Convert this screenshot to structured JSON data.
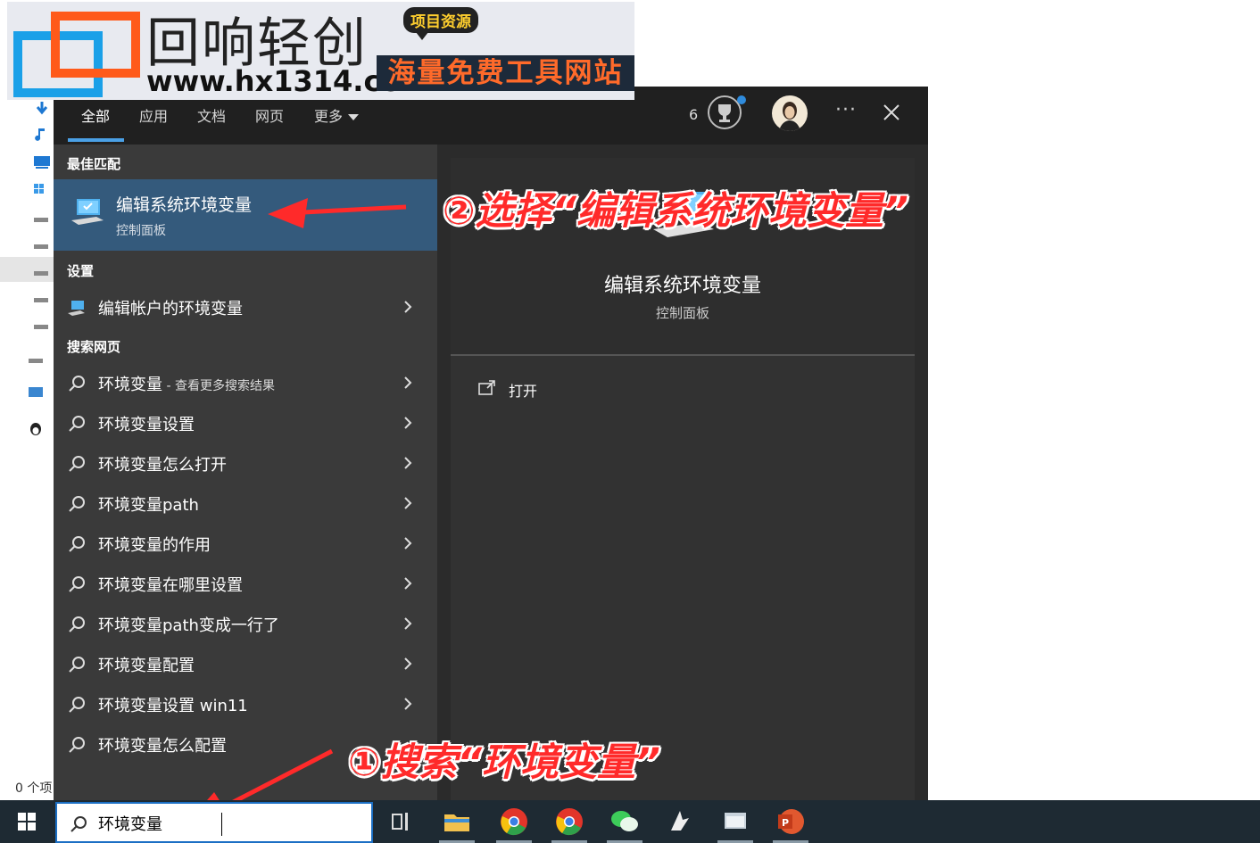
{
  "explorer": {
    "status_text": "0 个项"
  },
  "watermark": {
    "brand_cn": "回响轻创",
    "url": "www.hx1314.cc",
    "badge": "项目资源",
    "slogan": "海量免费工具网站"
  },
  "search": {
    "tabs": [
      {
        "label": "全部",
        "active": true
      },
      {
        "label": "应用"
      },
      {
        "label": "文档"
      },
      {
        "label": "网页"
      },
      {
        "label": "更多"
      }
    ],
    "points": "6",
    "best_match": {
      "header": "最佳匹配",
      "title": "编辑系统环境变量",
      "subtitle": "控制面板"
    },
    "settings": {
      "header": "设置",
      "items": [
        {
          "label": "编辑帐户的环境变量"
        }
      ]
    },
    "web": {
      "header": "搜索网页",
      "first": {
        "label": "环境变量",
        "suffix": " - 查看更多搜索结果"
      },
      "items": [
        {
          "label": "环境变量设置"
        },
        {
          "label": "环境变量怎么打开"
        },
        {
          "label": "环境变量path"
        },
        {
          "label": "环境变量的作用"
        },
        {
          "label": "环境变量在哪里设置"
        },
        {
          "label": "环境变量path变成一行了"
        },
        {
          "label": "环境变量配置"
        },
        {
          "label": "环境变量设置 win11"
        },
        {
          "label": "环境变量怎么配置"
        }
      ]
    },
    "preview": {
      "title": "编辑系统环境变量",
      "subtitle": "控制面板",
      "open_label": "打开"
    }
  },
  "annotations": {
    "step2": "②选择“编辑系统环境变量”",
    "step1": "①搜索“环境变量”"
  },
  "taskbar": {
    "search_value": "环境变量",
    "apps": [
      "task-view-icon",
      "file-explorer-icon",
      "chrome-icon",
      "chrome-icon",
      "wechat-icon",
      "app-bird-icon",
      "app-window-icon",
      "powerpoint-icon"
    ]
  },
  "colors": {
    "accent": "#4aa0e6",
    "best_match_bg": "#345a7c",
    "annotation_red": "#ff2a2a",
    "taskbar_bg": "#1e2a33"
  }
}
